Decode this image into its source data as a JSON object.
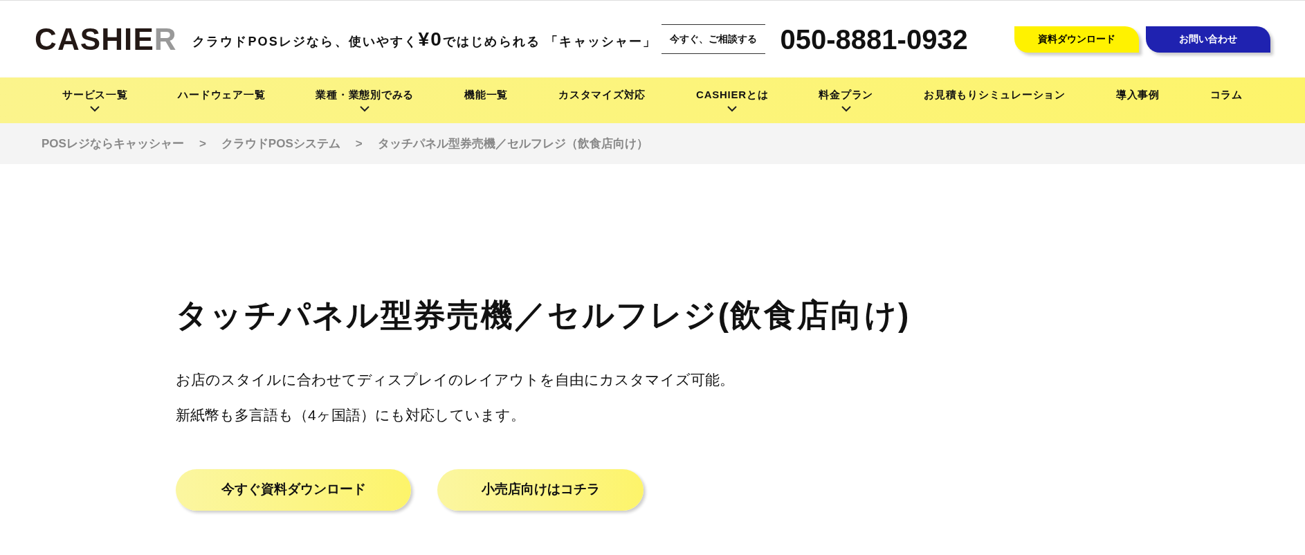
{
  "header": {
    "logo": {
      "main": "CASHIE",
      "accent": "R"
    },
    "tagline": {
      "before": "クラウドPOSレジなら、使いやすく",
      "highlight": "¥0",
      "after": "ではじめられる 「キャッシャー」"
    },
    "consult": "今すぐ、ご相談する",
    "phone": "050-8881-0932",
    "buttons": [
      {
        "label": "資料ダウンロード",
        "kind": "yellow"
      },
      {
        "label": "お問い合わせ",
        "kind": "blue"
      }
    ]
  },
  "nav": [
    {
      "label": "サービス一覧",
      "expanded": true
    },
    {
      "label": "ハードウェア一覧",
      "expanded": false
    },
    {
      "label": "業種・業態別でみる",
      "expanded": true
    },
    {
      "label": "機能一覧",
      "expanded": false
    },
    {
      "label": "カスタマイズ対応",
      "expanded": false
    },
    {
      "label": "CASHIERとは",
      "expanded": true
    },
    {
      "label": "料金プラン",
      "expanded": true
    },
    {
      "label": "お見積もりシミュレーション",
      "expanded": false
    },
    {
      "label": "導入事例",
      "expanded": false
    },
    {
      "label": "コラム",
      "expanded": false
    }
  ],
  "breadcrumb": {
    "separator": ">",
    "items": [
      "POSレジならキャッシャー",
      "クラウドPOSシステム",
      "タッチパネル型券売機／セルフレジ（飲食店向け）"
    ]
  },
  "hero": {
    "title": "タッチパネル型券売機／セルフレジ(飲食店向け)",
    "lines": [
      "お店のスタイルに合わせてディスプレイのレイアウトを自由にカスタマイズ可能。",
      "新紙幣も多言語も（4ヶ国語）にも対応しています。"
    ],
    "buttons": [
      "今すぐ資料ダウンロード",
      "小売店向けはコチラ"
    ]
  }
}
